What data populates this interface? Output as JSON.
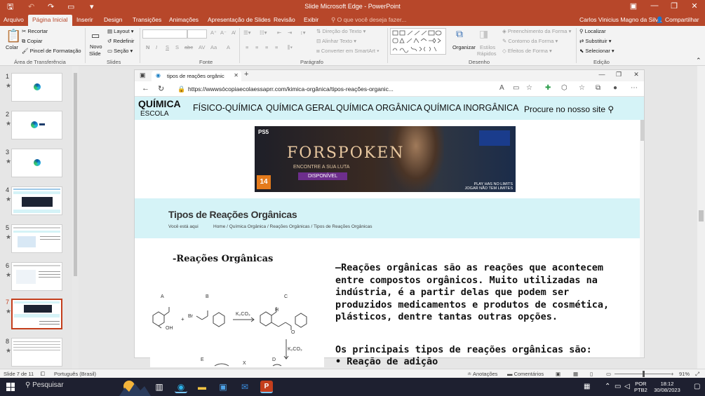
{
  "titlebar": {
    "title": "Slide Microsoft Edge  -  PowerPoint",
    "save_icon": "save-icon",
    "minimize": "—",
    "restore": "❐",
    "close": "✕"
  },
  "ribbon_tabs": [
    "Arquivo",
    "Página Inicial",
    "Inserir",
    "Design",
    "Transições",
    "Animações",
    "Apresentação de Slides",
    "Revisão",
    "Exibir"
  ],
  "tell_me": "O que você deseja fazer...",
  "user": "Carlos Vinicius Magno da Silva",
  "share": "Compartilhar",
  "ribbon": {
    "clipboard": {
      "paste": "Colar",
      "cut": "Recortar",
      "copy": "Copiar",
      "format_painter": "Pincel de Formatação",
      "group": "Área de Transferência"
    },
    "slides": {
      "new_slide": "Novo",
      "new_slide2": "Slide",
      "layout": "Layout",
      "reset": "Redefinir",
      "section": "Seção",
      "group": "Slides"
    },
    "font": {
      "group": "Fonte",
      "bold": "N",
      "italic": "I",
      "underline": "S",
      "shadow": "S",
      "strike": "abc",
      "spacing": "AV",
      "case": "Aa",
      "color": "A"
    },
    "paragraph": {
      "group": "Parágrafo",
      "direction": "Direção do Texto",
      "align": "Alinhar Texto",
      "smartart": "Converter em SmartArt"
    },
    "drawing": {
      "group": "Desenho",
      "arrange": "Organizar",
      "quick_styles": "Estilos",
      "quick_styles2": "Rápidos",
      "fill": "Preenchimento da Forma",
      "outline": "Contorno da Forma",
      "effects": "Efeitos de Forma"
    },
    "editing": {
      "group": "Edição",
      "find": "Localizar",
      "replace": "Substituir",
      "select": "Selecionar"
    }
  },
  "slides": [
    {
      "num": "1",
      "star": "★"
    },
    {
      "num": "2",
      "star": "★"
    },
    {
      "num": "3",
      "star": "★"
    },
    {
      "num": "4",
      "star": "★"
    },
    {
      "num": "5",
      "star": "★"
    },
    {
      "num": "6",
      "star": "★"
    },
    {
      "num": "7",
      "star": "★"
    },
    {
      "num": "8",
      "star": "★"
    }
  ],
  "browser": {
    "tab_title": "tipos de reações orgânic",
    "url": "https://wwwsócopiaecolaessaprr.com/kimica-orgânica/tipos-reações-organic...",
    "site_logo_top": "QUÍMICA",
    "site_logo_bottom": "ESCOLA",
    "nav": [
      "FÍSICO-QUÍMICA",
      "QUÍMICA GERAL",
      "QUÍMICA ORGÂNICA",
      "QUÍMICA INORGÂNICA"
    ],
    "search": "Procure no nosso site",
    "ad": {
      "platform": "PS5",
      "game": "FORSPOKEN",
      "tagline": "ENCONTRE A SUA LUTA",
      "available": "DISPONÍVEL",
      "age": "14",
      "play1": "PLAY HAS NO LIMITS",
      "play2": "JOGAR NÃO TEM LIMITES"
    },
    "page_title": "Tipos de Reações Orgânicas",
    "crumb_label": "Você está aqui",
    "crumb": "Home / Química Orgânica / Reações Orgânicas / Tipos de Reações Orgânicas",
    "section_heading": "-Reações Orgânicas",
    "paragraph": "—Reações orgânicas são as reações que acontecem entre compostos orgânicos. Muito utilizadas na indústria, é a partir delas que podem ser produzidos medicamentos e produtos de cosmética, plásticos, dentre tantas outras opções.",
    "paragraph2": "Os principais tipos de reações orgânicas são:",
    "bullet": "•  Reação de adição",
    "diagram": {
      "a": "A",
      "b": "B",
      "c": "C",
      "d": "D",
      "e": "E",
      "x": "X",
      "reagent1": "K₂CO₃",
      "reagent2": "K₂CO₃",
      "br": "Br",
      "oh": "OH",
      "o1": "O",
      "o2": "O",
      "h": "H"
    }
  },
  "status": {
    "slide": "Slide 7 de 11",
    "language": "Português (Brasil)",
    "notes": "Anotações",
    "comments": "Comentários",
    "zoom": "91%"
  },
  "taskbar": {
    "search": "Pesquisar",
    "lang1": "POR",
    "lang2": "PTB2",
    "time": "18:12",
    "date": "30/08/2023"
  },
  "colors": {
    "accent": "#b7472a",
    "site_bg": "#d5f3f7"
  }
}
